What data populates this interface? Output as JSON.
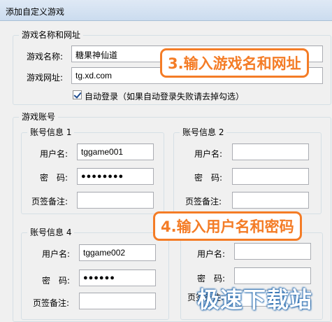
{
  "window": {
    "title": "添加自定义游戏"
  },
  "game_info": {
    "title": "游戏名称和网址",
    "name_label": "游戏名称:",
    "name_value": "糖果神仙道",
    "url_label": "游戏网址:",
    "url_value": "tg.xd.com",
    "auto_login_label": "自动登录（如果自动登录失败请去掉勾选）",
    "auto_login_checked": true
  },
  "accounts": {
    "title": "游戏账号",
    "account1": {
      "title": "账号信息 1",
      "user_label": "用户名:",
      "user_value": "tggame001",
      "pass_label": "密　码:",
      "pass_value": "●●●●●●●●",
      "note_label": "页签备注:",
      "note_value": ""
    },
    "account2": {
      "title": "账号信息 2",
      "user_label": "用户名:",
      "user_value": "",
      "pass_label": "密　码:",
      "pass_value": "",
      "note_label": "页签备注:",
      "note_value": ""
    },
    "account3": {
      "user_label": "用户名:",
      "user_value": "",
      "pass_label": "密　码:",
      "pass_value": "",
      "note_label": "页签备注:",
      "note_value": ""
    },
    "account4": {
      "title": "账号信息 4",
      "user_label": "用户名:",
      "user_value": "tggame002",
      "pass_label": "密　码:",
      "pass_value": "●●●●●●",
      "note_label": "页签备注:",
      "note_value": ""
    }
  },
  "callouts": {
    "step3": "3.输入游戏名和网址",
    "step4": "4.输入用户名和密码"
  },
  "watermark": "极速下载站",
  "colors": {
    "callout": "#f47c26",
    "watermark_outline": "#2a6db0"
  }
}
